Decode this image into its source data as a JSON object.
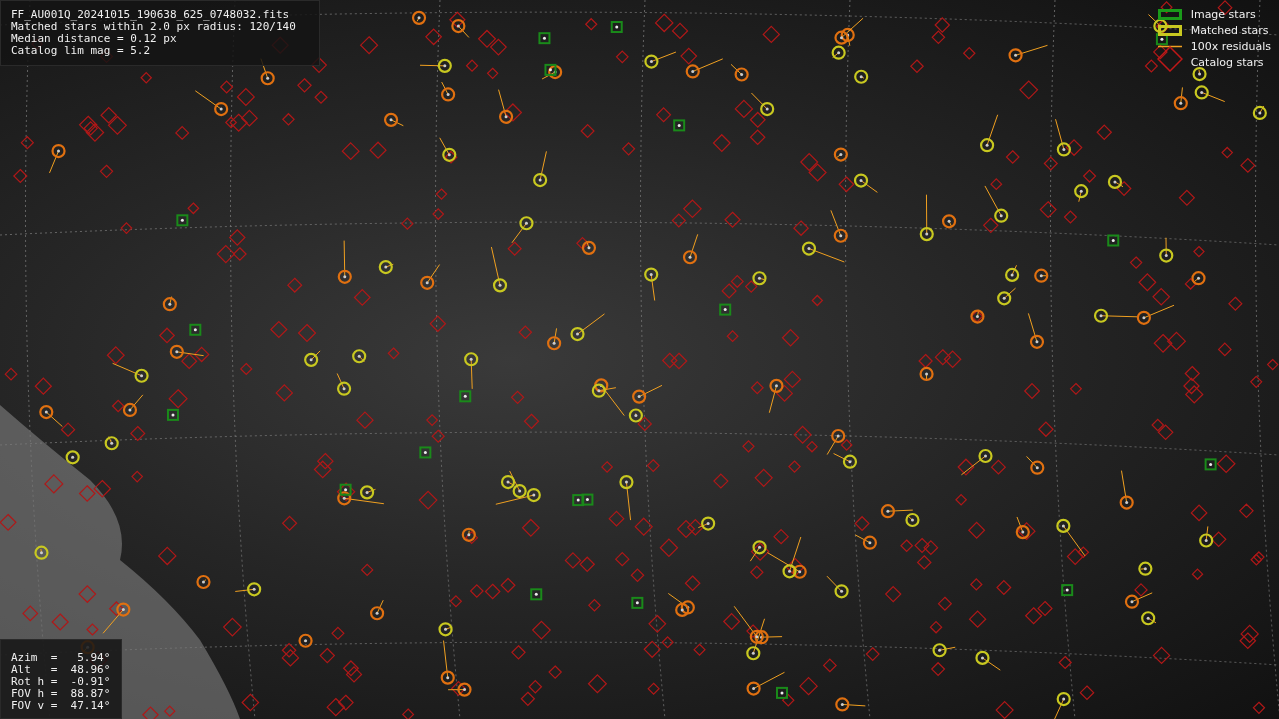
{
  "header": {
    "lines": [
      "FF_AU001Q_20241015_190638_625_0748032.fits",
      "Matched stars within 2.0 px radius: 120/140",
      "Median distance = 0.12 px",
      "Catalog lim mag = 5.2"
    ]
  },
  "legend": [
    {
      "kind": "image",
      "label": "Image stars"
    },
    {
      "kind": "matched",
      "label": "Matched stars"
    },
    {
      "kind": "residual",
      "label": "100x residuals"
    },
    {
      "kind": "catalog",
      "label": "Catalog stars"
    }
  ],
  "pointing": {
    "lines": [
      "Azim  =   5.94°",
      "Alt   =  48.96°",
      "Rot h =  -0.91°",
      "FOV h =  88.87°",
      "FOV v =  47.14°"
    ]
  }
}
